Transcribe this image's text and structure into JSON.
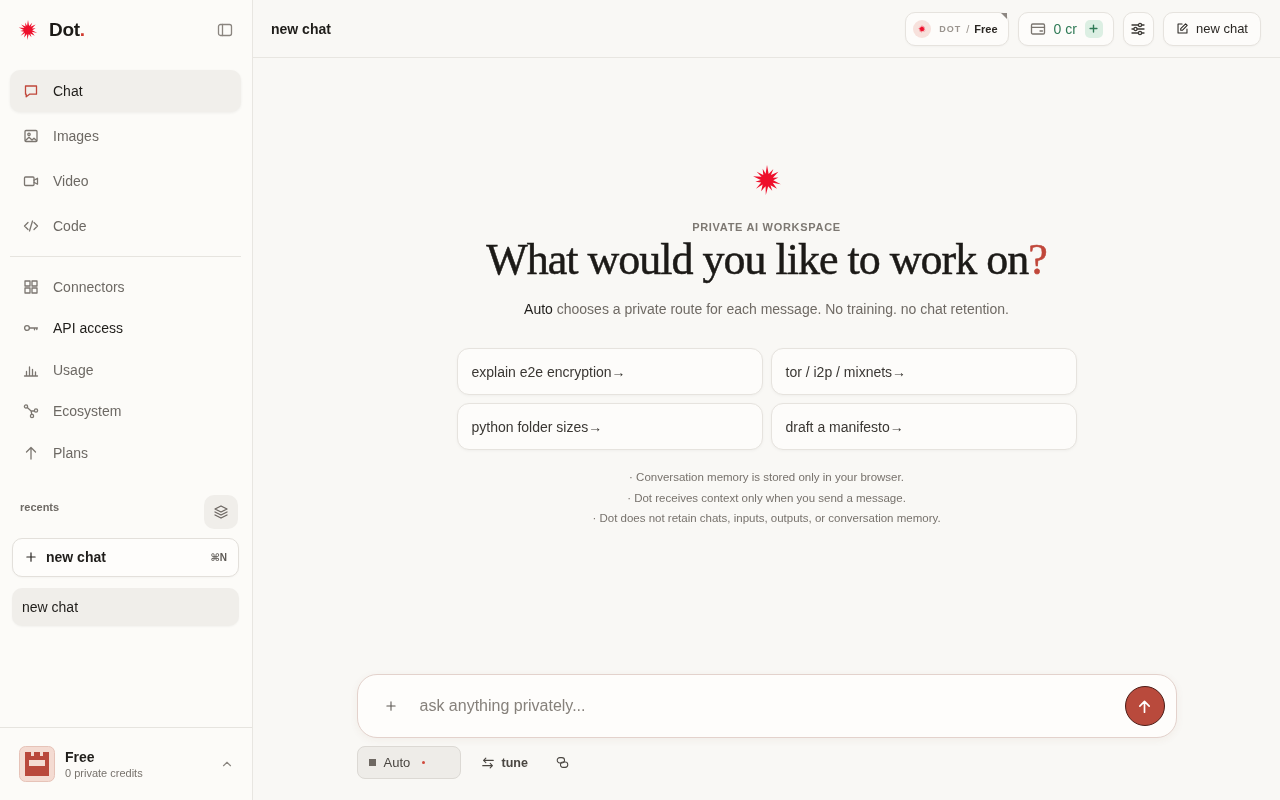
{
  "sidebar": {
    "brand": {
      "name": "Dot",
      "mark": "."
    },
    "primary_nav": [
      {
        "label": "Chat",
        "selected": true,
        "emphasized": false
      },
      {
        "label": "Images",
        "selected": false,
        "emphasized": false
      },
      {
        "label": "Video",
        "selected": false,
        "emphasized": false
      },
      {
        "label": "Code",
        "selected": false,
        "emphasized": false
      }
    ],
    "secondary_nav": [
      {
        "label": "Connectors",
        "selected": false,
        "emphasized": false
      },
      {
        "label": "API access",
        "selected": false,
        "emphasized": true
      },
      {
        "label": "Usage",
        "selected": false,
        "emphasized": false
      },
      {
        "label": "Ecosystem",
        "selected": false,
        "emphasized": false
      },
      {
        "label": "Plans",
        "selected": false,
        "emphasized": false
      }
    ],
    "recents": {
      "label": "recents",
      "new_chat": {
        "label": "new chat",
        "shortcut": "⌘N"
      },
      "items": [
        {
          "title": "new chat",
          "selected": true
        }
      ]
    },
    "account": {
      "plan": "Free",
      "credits": "0 private credits"
    }
  },
  "header": {
    "title": "new chat",
    "plan_badge": {
      "brand": "DOT",
      "separator": "/",
      "plan": "Free"
    },
    "credits": "0 cr",
    "new_chat": "new chat"
  },
  "hero": {
    "eyebrow": "PRIVATE AI WORKSPACE",
    "title": "What would you like to work on",
    "title_mark": "?",
    "subtitle": "**Auto** chooses a private route for each message. No training. no chat retention.",
    "suggestions": [
      "explain e2e encryption→",
      "tor / i2p / mixnets→",
      "python folder sizes→",
      "draft a manifesto→"
    ],
    "notes": [
      "· Conversation memory is stored only in your browser.",
      "· Dot receives context only when you send a message.",
      "· Dot does not retain chats, inputs, outputs, or conversation memory."
    ]
  },
  "composer": {
    "placeholder": "ask anything privately...",
    "model": "Auto",
    "tune": "tune"
  }
}
